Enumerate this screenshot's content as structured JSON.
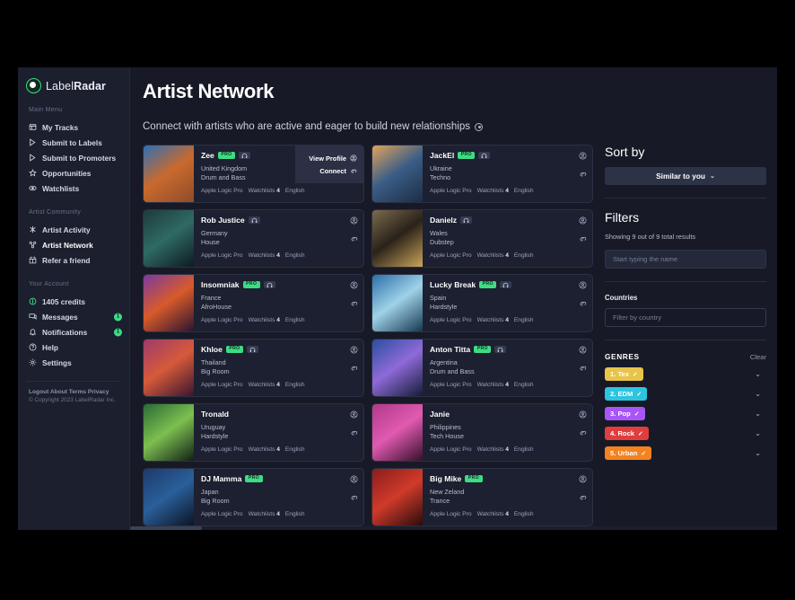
{
  "brand": {
    "name_light": "Label",
    "name_bold": "Radar"
  },
  "sidebar": {
    "sections": [
      {
        "title": "Main Menu",
        "items": [
          {
            "label": "My Tracks",
            "icon": "tracks-icon",
            "badge": ""
          },
          {
            "label": "Submit to Labels",
            "icon": "send-icon",
            "badge": ""
          },
          {
            "label": "Submit to Promoters",
            "icon": "send-icon",
            "badge": ""
          },
          {
            "label": "Opportunities",
            "icon": "star-icon",
            "badge": ""
          },
          {
            "label": "Watchlists",
            "icon": "eye-icon",
            "badge": ""
          }
        ]
      },
      {
        "title": "Artist Community",
        "items": [
          {
            "label": "Artist Activity",
            "icon": "activity-icon",
            "badge": ""
          },
          {
            "label": "Artist Network",
            "icon": "network-icon",
            "badge": ""
          },
          {
            "label": "Refer a friend",
            "icon": "gift-icon",
            "badge": ""
          }
        ]
      },
      {
        "title": "Your Account",
        "items": [
          {
            "label": "1405 credits",
            "icon": "credits-icon",
            "badge": ""
          },
          {
            "label": "Messages",
            "icon": "message-icon",
            "badge": "1"
          },
          {
            "label": "Notifications",
            "icon": "bell-icon",
            "badge": "1"
          },
          {
            "label": "Help",
            "icon": "help-icon",
            "badge": ""
          },
          {
            "label": "Settings",
            "icon": "gear-icon",
            "badge": ""
          }
        ]
      }
    ],
    "footer_links": "Logout About Terms Privacy",
    "copyright": "© Copyright 2023 LabelRadar Inc."
  },
  "header": {
    "title": "Artist Network",
    "subtitle": "Connect with artists who are active and eager to build new relationships"
  },
  "card_labels": {
    "daw": "Apple Logic Pro",
    "watchlists_label": "Watchlists",
    "watchlists_count": "4",
    "language": "English",
    "view_profile": "View Profile",
    "connect": "Connect"
  },
  "artists": [
    {
      "name": "Zee",
      "country": "United Kingdom",
      "genre": "Drum and Bass",
      "pro": true,
      "chip": true,
      "hovered": true,
      "thumb": "c1"
    },
    {
      "name": "JackEl",
      "country": "Ukraine",
      "genre": "Techno",
      "pro": true,
      "chip": true,
      "hovered": false,
      "thumb": "c2"
    },
    {
      "name": "Rob Justice",
      "country": "Germany",
      "genre": "House",
      "pro": false,
      "chip": true,
      "hovered": false,
      "thumb": "c3"
    },
    {
      "name": "Danielz",
      "country": "Wales",
      "genre": "Dubstep",
      "pro": false,
      "chip": true,
      "hovered": false,
      "thumb": "c4"
    },
    {
      "name": "Insomniak",
      "country": "France",
      "genre": "AfroHouse",
      "pro": true,
      "chip": true,
      "hovered": false,
      "thumb": "c5"
    },
    {
      "name": "Lucky Break",
      "country": "Spain",
      "genre": "Hardstyle",
      "pro": true,
      "chip": true,
      "hovered": false,
      "thumb": "c6"
    },
    {
      "name": "Khloe",
      "country": "Thailand",
      "genre": "Big Room",
      "pro": true,
      "chip": true,
      "hovered": false,
      "thumb": "c7"
    },
    {
      "name": "Anton Titta",
      "country": "Argentina",
      "genre": "Drum and Bass",
      "pro": true,
      "chip": true,
      "hovered": false,
      "thumb": "c8"
    },
    {
      "name": "Tronald",
      "country": "Uruguay",
      "genre": "Hardstyle",
      "pro": false,
      "chip": false,
      "hovered": false,
      "thumb": "c9"
    },
    {
      "name": "Janie",
      "country": "Philippines",
      "genre": "Tech House",
      "pro": false,
      "chip": false,
      "hovered": false,
      "thumb": "c10"
    },
    {
      "name": "DJ Mamma",
      "country": "Japan",
      "genre": "Big Room",
      "pro": true,
      "chip": false,
      "hovered": false,
      "thumb": "c11"
    },
    {
      "name": "Big Mike",
      "country": "New Zeland",
      "genre": "Trance",
      "pro": true,
      "chip": false,
      "hovered": false,
      "thumb": "c12"
    }
  ],
  "right_panel": {
    "sort_title": "Sort by",
    "sort_value": "Similar to you",
    "sort_chevron": "⌄",
    "filters_title": "Filters",
    "results_text": "Showing 9 out of 9 total results",
    "name_placeholder": "Start typing the name",
    "countries_label": "Countries",
    "country_placeholder": "Filter by country",
    "genres_title": "GENRES",
    "genres_clear": "Clear",
    "genres": [
      {
        "label": "1. Tex",
        "color": "#e8c44a",
        "checked": "✓"
      },
      {
        "label": "2. EDM",
        "color": "#2ec4e0",
        "checked": "✓"
      },
      {
        "label": "3. Pop",
        "color": "#a855f7",
        "checked": "✓"
      },
      {
        "label": "4. Rock",
        "color": "#e03e3e",
        "checked": "✓"
      },
      {
        "label": "5. Urban",
        "color": "#f58220",
        "checked": "✓"
      }
    ]
  }
}
